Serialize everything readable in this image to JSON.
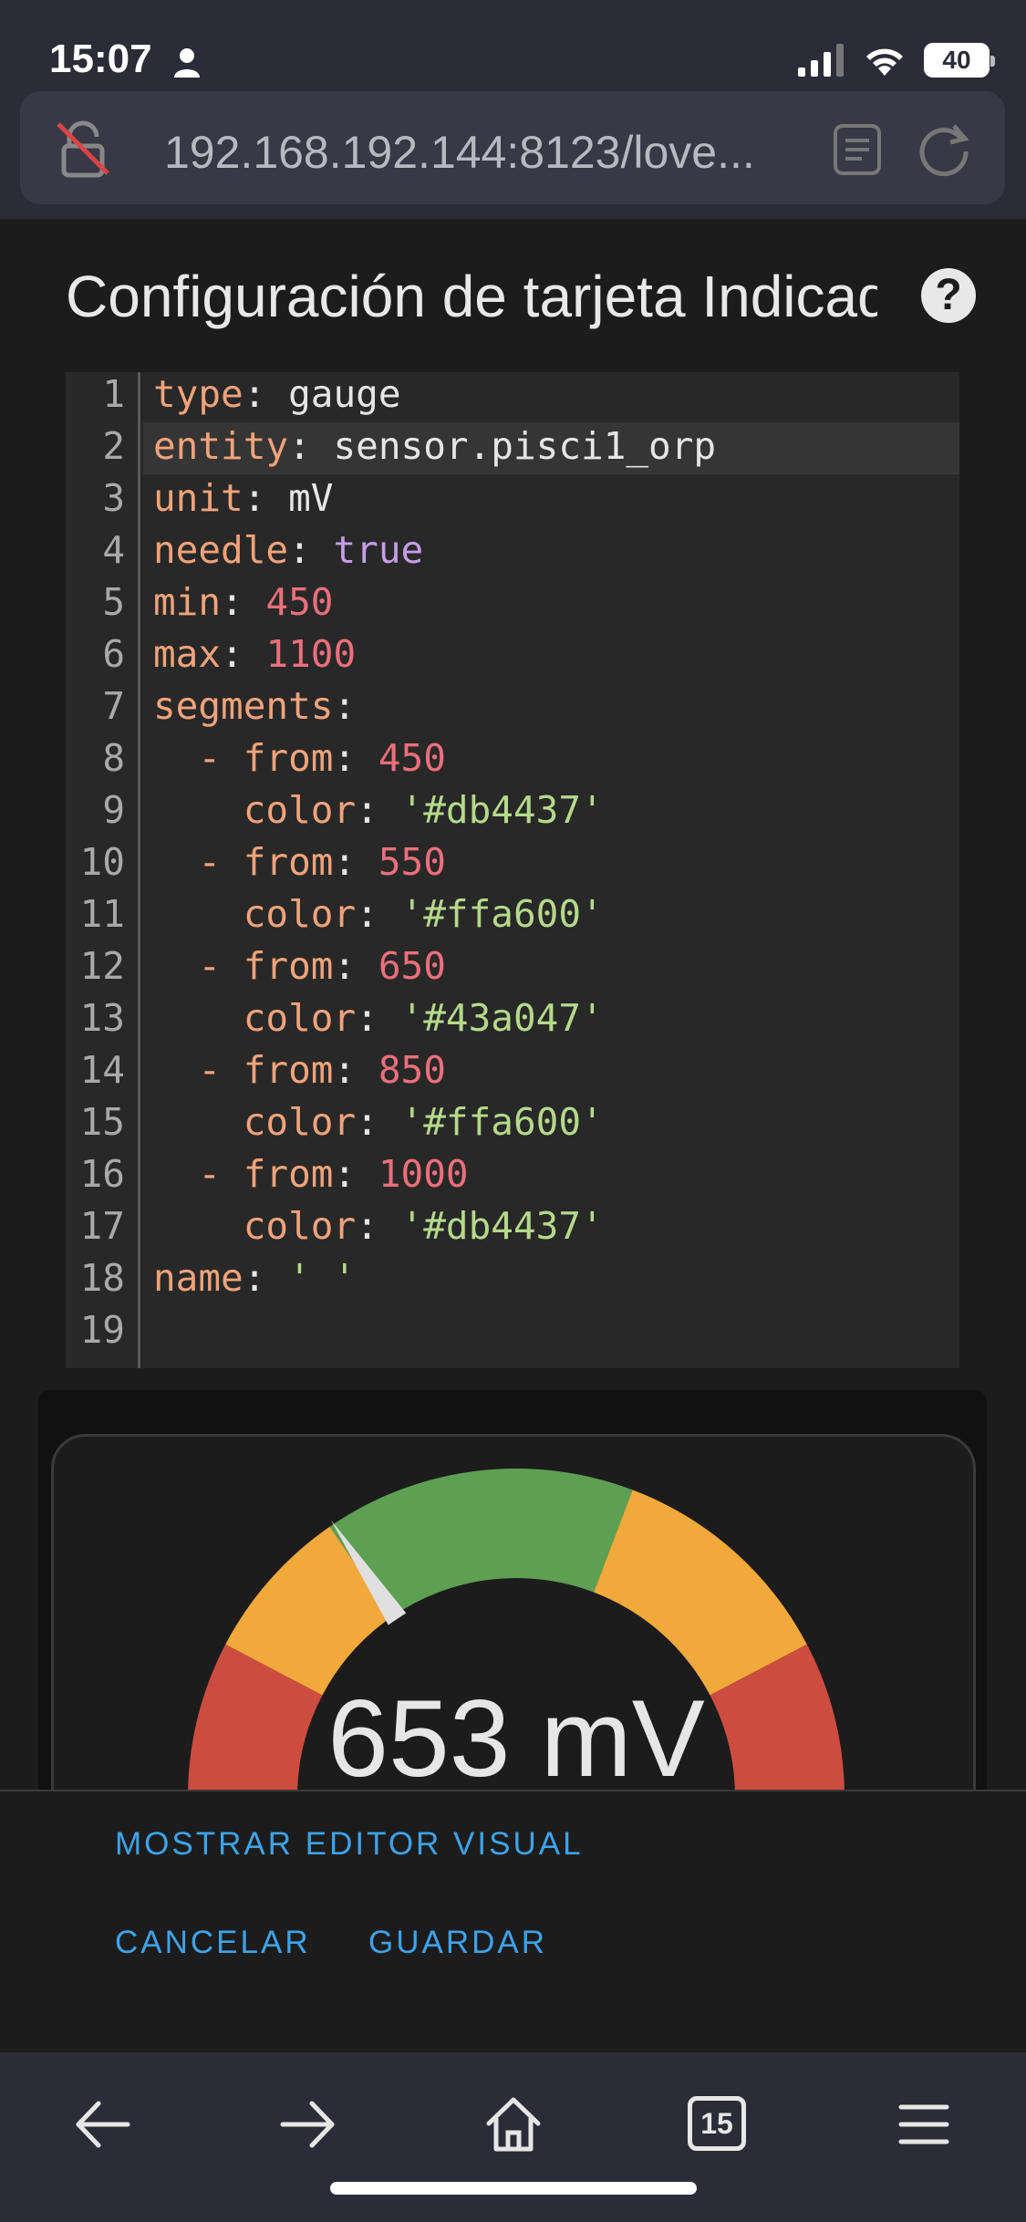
{
  "status": {
    "time": "15:07",
    "battery": "40"
  },
  "browser": {
    "url": "192.168.192.144:8123/love...",
    "tab_count": "15"
  },
  "dialog": {
    "title": "Configuración de tarjeta Indicador",
    "help": "?",
    "line_numbers": [
      "1",
      "2",
      "3",
      "4",
      "5",
      "6",
      "7",
      "8",
      "9",
      "10",
      "11",
      "12",
      "13",
      "14",
      "15",
      "16",
      "17",
      "18",
      "19"
    ],
    "code": {
      "l1": {
        "key": "type",
        "value": "gauge"
      },
      "l2": {
        "key": "entity",
        "value": "sensor.pisci1_orp"
      },
      "l3": {
        "key": "unit",
        "value": "mV"
      },
      "l4": {
        "key": "needle",
        "value": "true"
      },
      "l5": {
        "key": "min",
        "value": "450"
      },
      "l6": {
        "key": "max",
        "value": "1100"
      },
      "l7": {
        "key": "segments"
      },
      "segments": [
        {
          "from": "450",
          "color": "'#db4437'"
        },
        {
          "from": "550",
          "color": "'#ffa600'"
        },
        {
          "from": "650",
          "color": "'#43a047'"
        },
        {
          "from": "850",
          "color": "'#ffa600'"
        },
        {
          "from": "1000",
          "color": "'#db4437'"
        }
      ],
      "from_key": "from",
      "color_key": "color",
      "l18": {
        "key": "name",
        "value": "' '"
      }
    },
    "show_visual_editor": "MOSTRAR EDITOR VISUAL",
    "cancel": "CANCELAR",
    "save": "GUARDAR"
  },
  "gauge": {
    "value_text": "653 mV",
    "value": 653,
    "min": 450,
    "max": 1100,
    "segment_colors": {
      "red": "#db4437",
      "orange": "#ffa600",
      "green": "#43a047"
    }
  },
  "colors": {
    "accent": "#3ea3ea"
  }
}
